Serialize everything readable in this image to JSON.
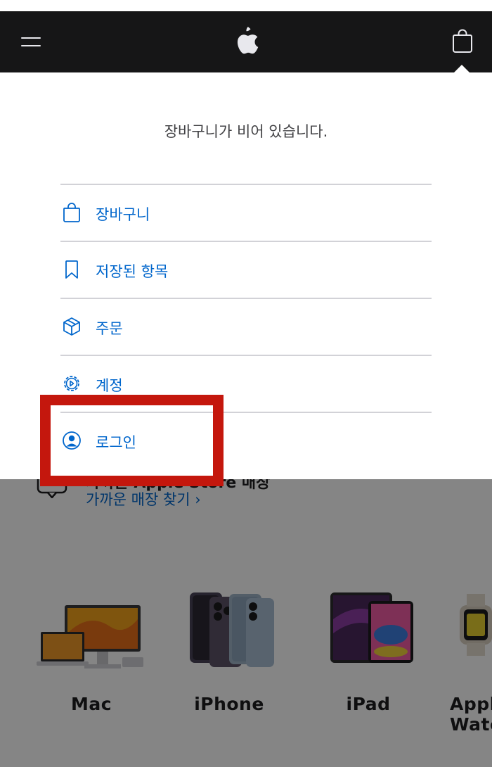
{
  "nav": {
    "menu_icon": "hamburger-icon",
    "logo_icon": "apple-logo-icon",
    "bag_icon": "shopping-bag-icon",
    "background": "#161617"
  },
  "bag_flyout": {
    "empty_message": "장바구니가 비어 있습니다.",
    "items": [
      {
        "label": "장바구니",
        "icon": "bag-icon"
      },
      {
        "label": "저장된 항목",
        "icon": "bookmark-icon"
      },
      {
        "label": "주문",
        "icon": "box-icon"
      },
      {
        "label": "계정",
        "icon": "gear-icon"
      },
      {
        "label": "로그인",
        "icon": "person-circle-icon"
      }
    ],
    "link_color": "#0066cc"
  },
  "background_page": {
    "store_title": "가까운 Apple Store 매장",
    "store_link": "가까운 매장 찾기 ›",
    "categories": [
      {
        "label": "Mac"
      },
      {
        "label": "iPhone"
      },
      {
        "label": "iPad"
      },
      {
        "label": "Apple Watch"
      }
    ]
  },
  "highlight_color": "#c4170d"
}
